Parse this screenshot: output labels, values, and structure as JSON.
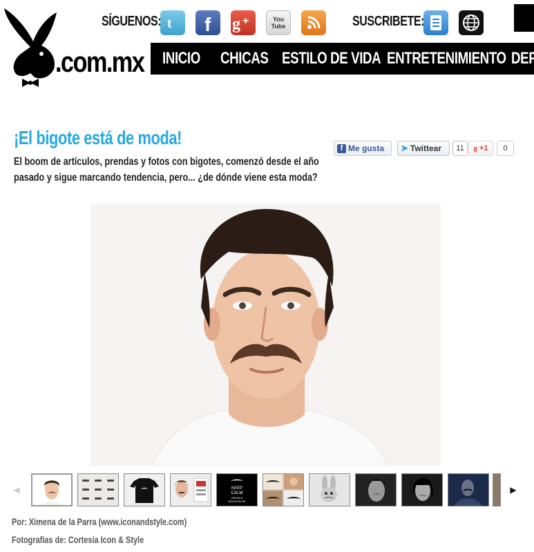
{
  "header": {
    "logo_text": ".com.mx",
    "social_label": "SÍGUENOS:",
    "subscribe_label": "SUSCRIBETE:",
    "social_icons": [
      {
        "name": "twitter-icon",
        "color": "#4fb3d9"
      },
      {
        "name": "facebook-icon",
        "color": "#3b5998"
      },
      {
        "name": "google-plus-icon",
        "color": "#d6402f"
      },
      {
        "name": "youtube-icon",
        "color": "#e8e8e8"
      },
      {
        "name": "rss-icon",
        "color": "#f08a24"
      }
    ],
    "youtube_text": "You Tube",
    "subscribe_icons": [
      {
        "name": "newsletter-icon",
        "color": "#3a8fd8"
      },
      {
        "name": "globe-icon",
        "color": "#111111"
      }
    ]
  },
  "nav": {
    "items": [
      "INICIO",
      "CHICAS",
      "ESTILO DE VIDA",
      "ENTRETENIMIENTO",
      "DEPO"
    ]
  },
  "article": {
    "title": "¡El bigote está de moda!",
    "subtitle": "El boom de artículos, prendas y fotos con bigotes, comenzó desde el año pasado y sigue marcando tendencia, pero... ¿de dónde viene esta moda?",
    "credit_author": "Por: Ximena de la Parra (www.iconandstyle.com)",
    "credit_photos": "Fotografías de: Cortesía Icon & Style"
  },
  "share": {
    "facebook_label": "Me gusta",
    "twitter_label": "Twittear",
    "twitter_count": "11",
    "gplus_label": "+1",
    "gplus_count": "0"
  },
  "carousel": {
    "thumbs": [
      "man-mustache",
      "mustache-styles",
      "black-tshirt",
      "woman-mustache",
      "keep-calm-poster",
      "mustache-collage",
      "bugs-bunny",
      "man-bw",
      "woman-bw",
      "man-dark",
      "partial"
    ],
    "keep_calm_text": "KEEP CALM AND GROW A MOUSTACHE"
  },
  "colors": {
    "accent": "#27a8e0",
    "nav_bg": "#000000"
  }
}
